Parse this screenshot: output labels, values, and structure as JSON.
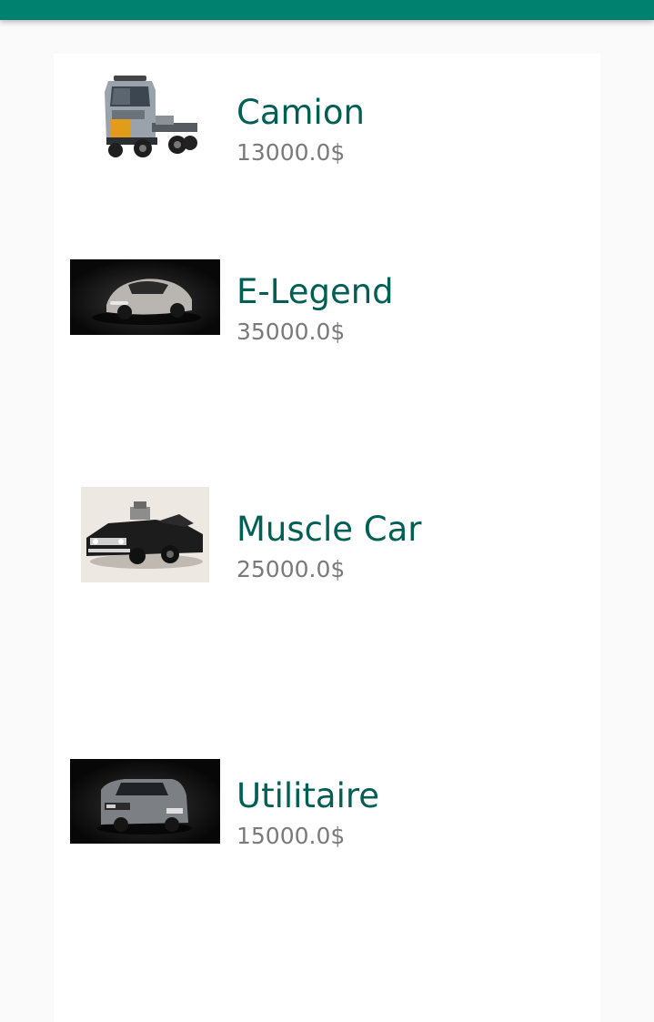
{
  "vehicles": [
    {
      "name": "Camion",
      "price": "13000.0$",
      "image_icon": "truck-icon"
    },
    {
      "name": "E-Legend",
      "price": "35000.0$",
      "image_icon": "coupe-car-icon"
    },
    {
      "name": "Muscle Car",
      "price": "25000.0$",
      "image_icon": "muscle-car-icon"
    },
    {
      "name": "Utilitaire",
      "price": "15000.0$",
      "image_icon": "van-icon"
    }
  ],
  "colors": {
    "app_bar": "#00806e",
    "name_text": "#005f55",
    "price_text": "#7a7a7a"
  }
}
